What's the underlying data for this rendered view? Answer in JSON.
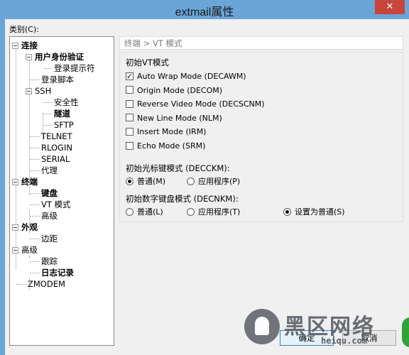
{
  "window": {
    "title": "extmail属性",
    "close_glyph": "✕"
  },
  "sidebar": {
    "category_label": "类别(C):",
    "tree": {
      "connect": "连接",
      "user_auth": "用户身份验证",
      "login_prompt": "登录提示符",
      "login_script": "登录脚本",
      "ssh": "SSH",
      "security": "安全性",
      "tunnel": "隧道",
      "sftp": "SFTP",
      "telnet": "TELNET",
      "rlogin": "RLOGIN",
      "serial": "SERIAL",
      "proxy": "代理",
      "terminal": "终端",
      "keyboard": "键盘",
      "vt_mode": "VT 模式",
      "advanced_t": "高级",
      "appearance": "外观",
      "margin": "边距",
      "advanced": "高级",
      "trace": "跟踪",
      "log": "日志记录",
      "zmodem": "ZMODEM"
    }
  },
  "main": {
    "breadcrumb": "终端 > VT 模式",
    "init_vt": {
      "label": "初始VT模式",
      "options": [
        {
          "label": "Auto Wrap Mode (DECAWM)",
          "checked": true
        },
        {
          "label": "Origin Mode (DECOM)",
          "checked": false
        },
        {
          "label": "Reverse Video Mode (DECSCNM)",
          "checked": false
        },
        {
          "label": "New Line Mode (NLM)",
          "checked": false
        },
        {
          "label": "Insert Mode (IRM)",
          "checked": false
        },
        {
          "label": "Echo Mode (SRM)",
          "checked": false
        }
      ]
    },
    "cursor_mode": {
      "label": "初始光标键模式 (DECCKM):",
      "normal": "普通(M)",
      "app": "应用程序(P)",
      "selected": "normal"
    },
    "keypad_mode": {
      "label": "初始数字键盘模式 (DECNKM):",
      "normal": "普通(L)",
      "app": "应用程序(T)",
      "set_normal": "设置为普通(S)",
      "selected": "set_normal"
    }
  },
  "buttons": {
    "ok": "确定",
    "cancel": "取消"
  },
  "watermark": {
    "text": "黑区网络",
    "url": "heiqu.com"
  }
}
